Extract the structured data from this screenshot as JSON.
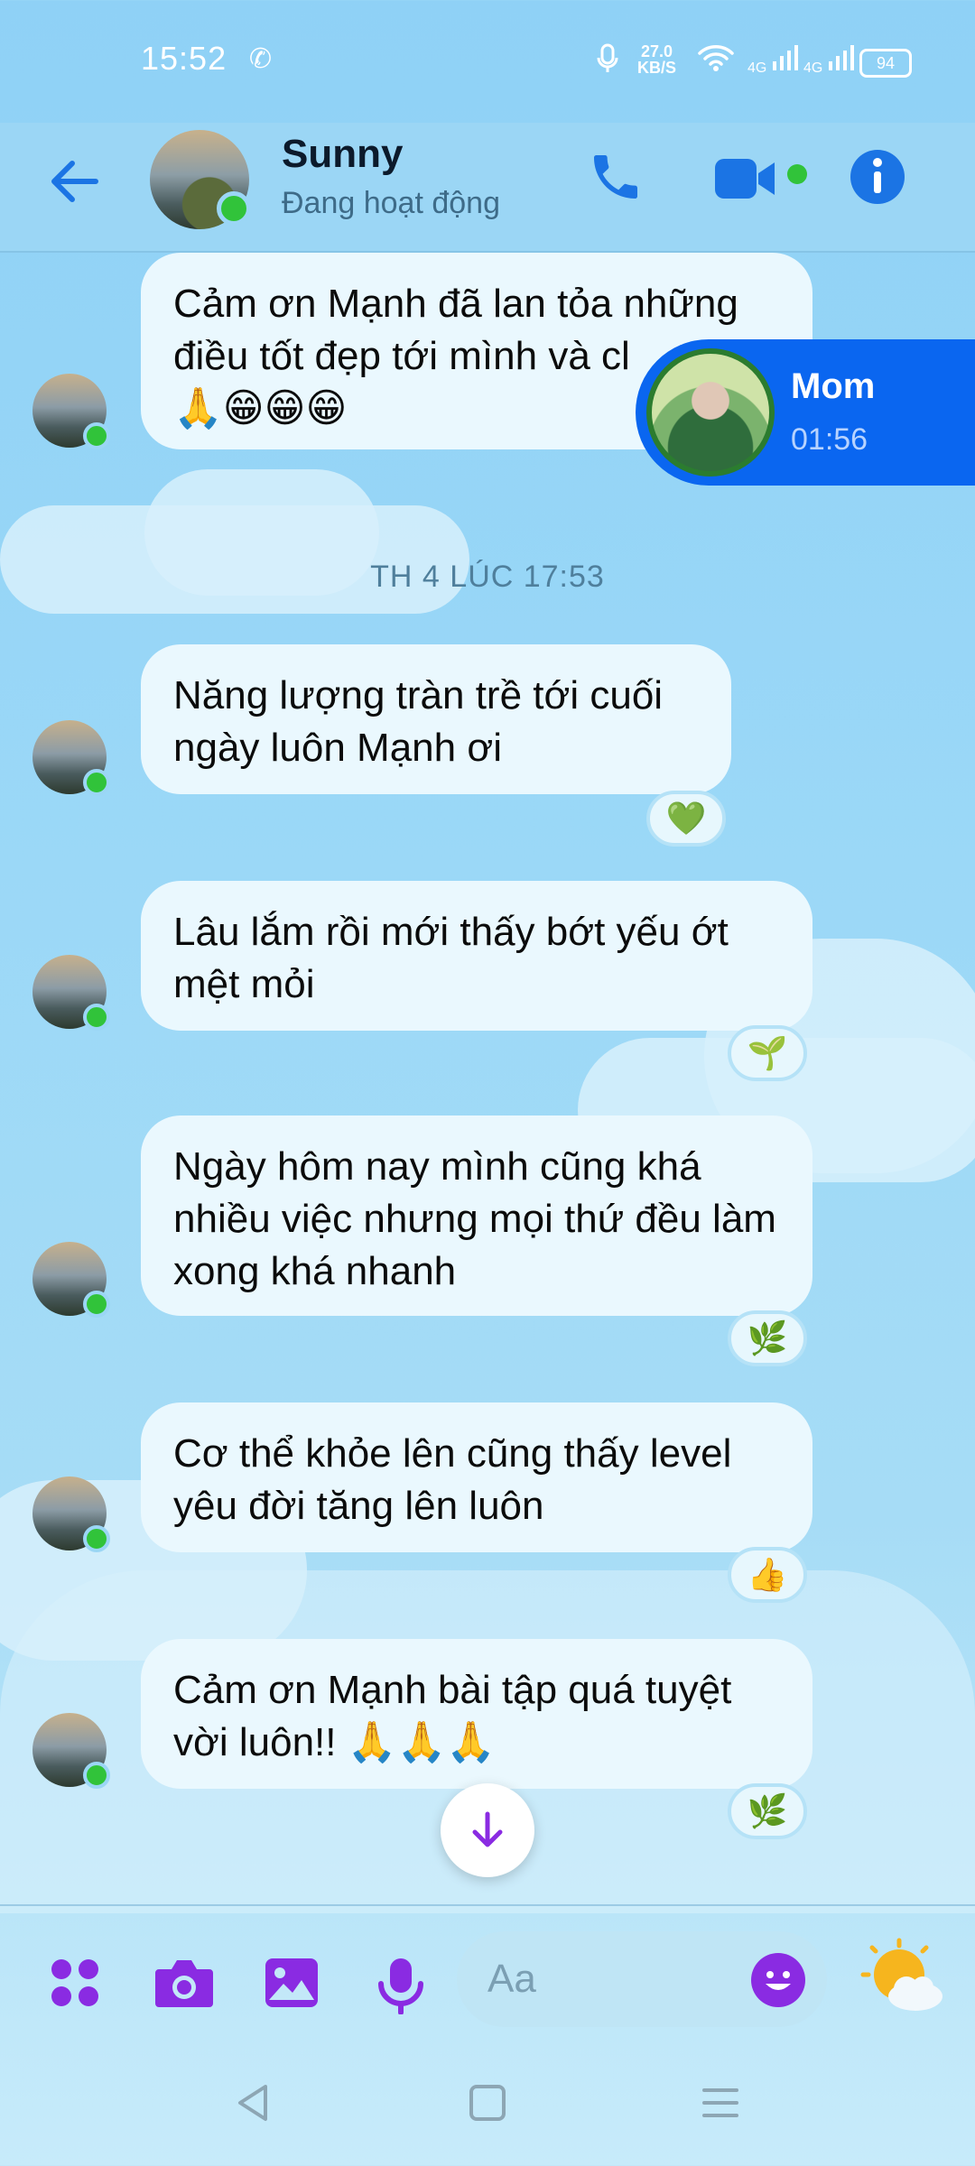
{
  "status_bar": {
    "time": "15:52",
    "speed_value": "27.0",
    "speed_unit": "KB/S",
    "net1": "4G",
    "net2": "4G",
    "battery": "94"
  },
  "header": {
    "contact_name": "Sunny",
    "contact_status": "Đang hoạt động"
  },
  "date_separator": "TH 4 LÚC 17:53",
  "messages": [
    {
      "text": "Cảm ơn Mạnh đã lan tỏa những điều tốt đẹp tới mình và cl",
      "emoji": "🙏😁😁😁"
    },
    {
      "text": "Năng lượng tràn trề tới cuối ngày luôn Mạnh ơi",
      "reaction": "💚"
    },
    {
      "text": "Lâu lắm rồi mới thấy bớt yếu ớt mệt mỏi",
      "reaction": "🌱"
    },
    {
      "text": "Ngày hôm nay mình cũng khá nhiều việc nhưng mọi thứ đều làm xong khá nhanh",
      "reaction": "🌿"
    },
    {
      "text": "Cơ thể khỏe lên cũng thấy level yêu đời tăng lên luôn",
      "reaction": "👍"
    },
    {
      "text": "Cảm ơn Mạnh bài tập quá tuyệt vời luôn!! 🙏🙏🙏",
      "reaction": "🌿"
    }
  ],
  "chat_head": {
    "name": "Mom",
    "time": "01:56"
  },
  "composer": {
    "placeholder": "Aa"
  },
  "icons": {
    "back": "arrow-left-icon",
    "call": "phone-icon",
    "video": "video-camera-icon",
    "info": "info-icon",
    "apps": "grid-dots-icon",
    "camera": "camera-icon",
    "gallery": "image-icon",
    "mic": "microphone-icon",
    "emoji": "smiley-icon",
    "weather": "sun-cloud-icon",
    "scroll": "arrow-down-icon"
  },
  "colors": {
    "accent": "#1b74e4",
    "composer_accent": "#8a2be2",
    "online": "#31c33a",
    "chat_head_bg": "#0a66f0"
  }
}
